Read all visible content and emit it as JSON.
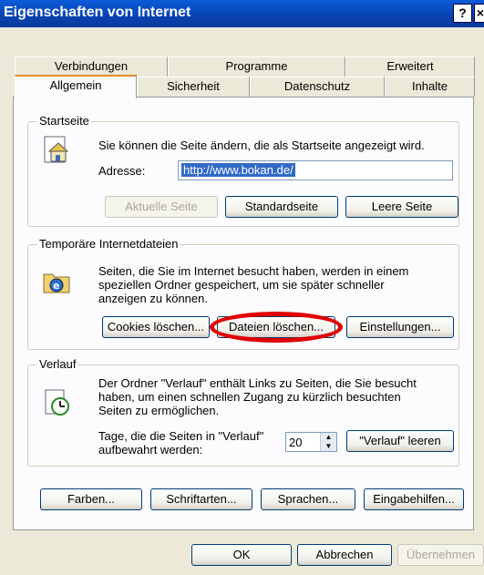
{
  "window": {
    "title": "Eigenschaften von Internet",
    "help": "?",
    "close": "×"
  },
  "tabs": {
    "back_row": [
      "Verbindungen",
      "Programme",
      "Erweitert"
    ],
    "front_row": [
      "Allgemein",
      "Sicherheit",
      "Datenschutz",
      "Inhalte"
    ],
    "active": "Allgemein"
  },
  "startseite": {
    "legend": "Startseite",
    "description": "Sie können die Seite ändern, die als Startseite angezeigt wird.",
    "address_label": "Adresse:",
    "address_value": "http://www.bokan.de/",
    "btn_current": "Aktuelle Seite",
    "btn_default": "Standardseite",
    "btn_blank": "Leere Seite"
  },
  "temp": {
    "legend": "Temporäre Internetdateien",
    "line1": "Seiten, die Sie im Internet besucht haben, werden in einem",
    "line2": "speziellen Ordner gespeichert, um sie später schneller",
    "line3": "anzeigen zu können.",
    "btn_cookies": "Cookies löschen...",
    "btn_files": "Dateien löschen...",
    "btn_settings": "Einstellungen..."
  },
  "history": {
    "legend": "Verlauf",
    "line1": "Der Ordner \"Verlauf\" enthält Links zu Seiten, die Sie besucht",
    "line2": "haben, um einen schnellen Zugang zu kürzlich besuchten",
    "line3": "Seiten zu ermöglichen.",
    "days_line1": "Tage, die die Seiten in \"Verlauf\"",
    "days_line2": "aufbewahrt werden:",
    "days_value": "20",
    "btn_clear": "\"Verlauf\" leeren"
  },
  "bottom_buttons": {
    "colors": "Farben...",
    "fonts": "Schriftarten...",
    "languages": "Sprachen...",
    "accessibility": "Eingabehilfen..."
  },
  "dialog_buttons": {
    "ok": "OK",
    "cancel": "Abbrechen",
    "apply": "Übernehmen"
  }
}
